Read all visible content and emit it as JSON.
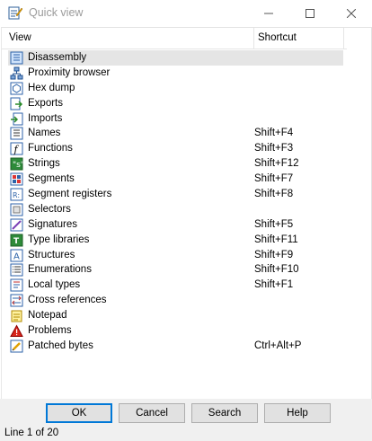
{
  "window": {
    "title": "Quick view",
    "icon": "quick-view-icon",
    "controls": [
      "minimize-icon",
      "maximize-icon",
      "close-icon"
    ]
  },
  "list": {
    "columns": {
      "view": "View",
      "shortcut": "Shortcut"
    },
    "rows": [
      {
        "label": "Disassembly",
        "shortcut": "",
        "icon": "disassembly-icon",
        "selected": true
      },
      {
        "label": "Proximity browser",
        "shortcut": "",
        "icon": "proximity-browser-icon"
      },
      {
        "label": "Hex dump",
        "shortcut": "",
        "icon": "hex-dump-icon"
      },
      {
        "label": "Exports",
        "shortcut": "",
        "icon": "exports-icon"
      },
      {
        "label": "Imports",
        "shortcut": "",
        "icon": "imports-icon"
      },
      {
        "label": "Names",
        "shortcut": "Shift+F4",
        "icon": "names-icon"
      },
      {
        "label": "Functions",
        "shortcut": "Shift+F3",
        "icon": "functions-icon"
      },
      {
        "label": "Strings",
        "shortcut": "Shift+F12",
        "icon": "strings-icon"
      },
      {
        "label": "Segments",
        "shortcut": "Shift+F7",
        "icon": "segments-icon"
      },
      {
        "label": "Segment registers",
        "shortcut": "Shift+F8",
        "icon": "segment-registers-icon"
      },
      {
        "label": "Selectors",
        "shortcut": "",
        "icon": "selectors-icon"
      },
      {
        "label": "Signatures",
        "shortcut": "Shift+F5",
        "icon": "signatures-icon"
      },
      {
        "label": "Type libraries",
        "shortcut": "Shift+F11",
        "icon": "type-libraries-icon"
      },
      {
        "label": "Structures",
        "shortcut": "Shift+F9",
        "icon": "structures-icon"
      },
      {
        "label": "Enumerations",
        "shortcut": "Shift+F10",
        "icon": "enumerations-icon"
      },
      {
        "label": "Local types",
        "shortcut": "Shift+F1",
        "icon": "local-types-icon"
      },
      {
        "label": "Cross references",
        "shortcut": "",
        "icon": "cross-references-icon"
      },
      {
        "label": "Notepad",
        "shortcut": "",
        "icon": "notepad-icon"
      },
      {
        "label": "Problems",
        "shortcut": "",
        "icon": "problems-icon"
      },
      {
        "label": "Patched bytes",
        "shortcut": "Ctrl+Alt+P",
        "icon": "patched-bytes-icon"
      }
    ]
  },
  "buttons": {
    "ok": "OK",
    "cancel": "Cancel",
    "search": "Search",
    "help": "Help"
  },
  "status": {
    "text": "Line 1 of 20"
  },
  "colors": {
    "selection": "#e5e5e5",
    "default_button_border": "#0078d7",
    "footer_bg": "#f0f0f0",
    "title_text": "#9b9b9b"
  }
}
